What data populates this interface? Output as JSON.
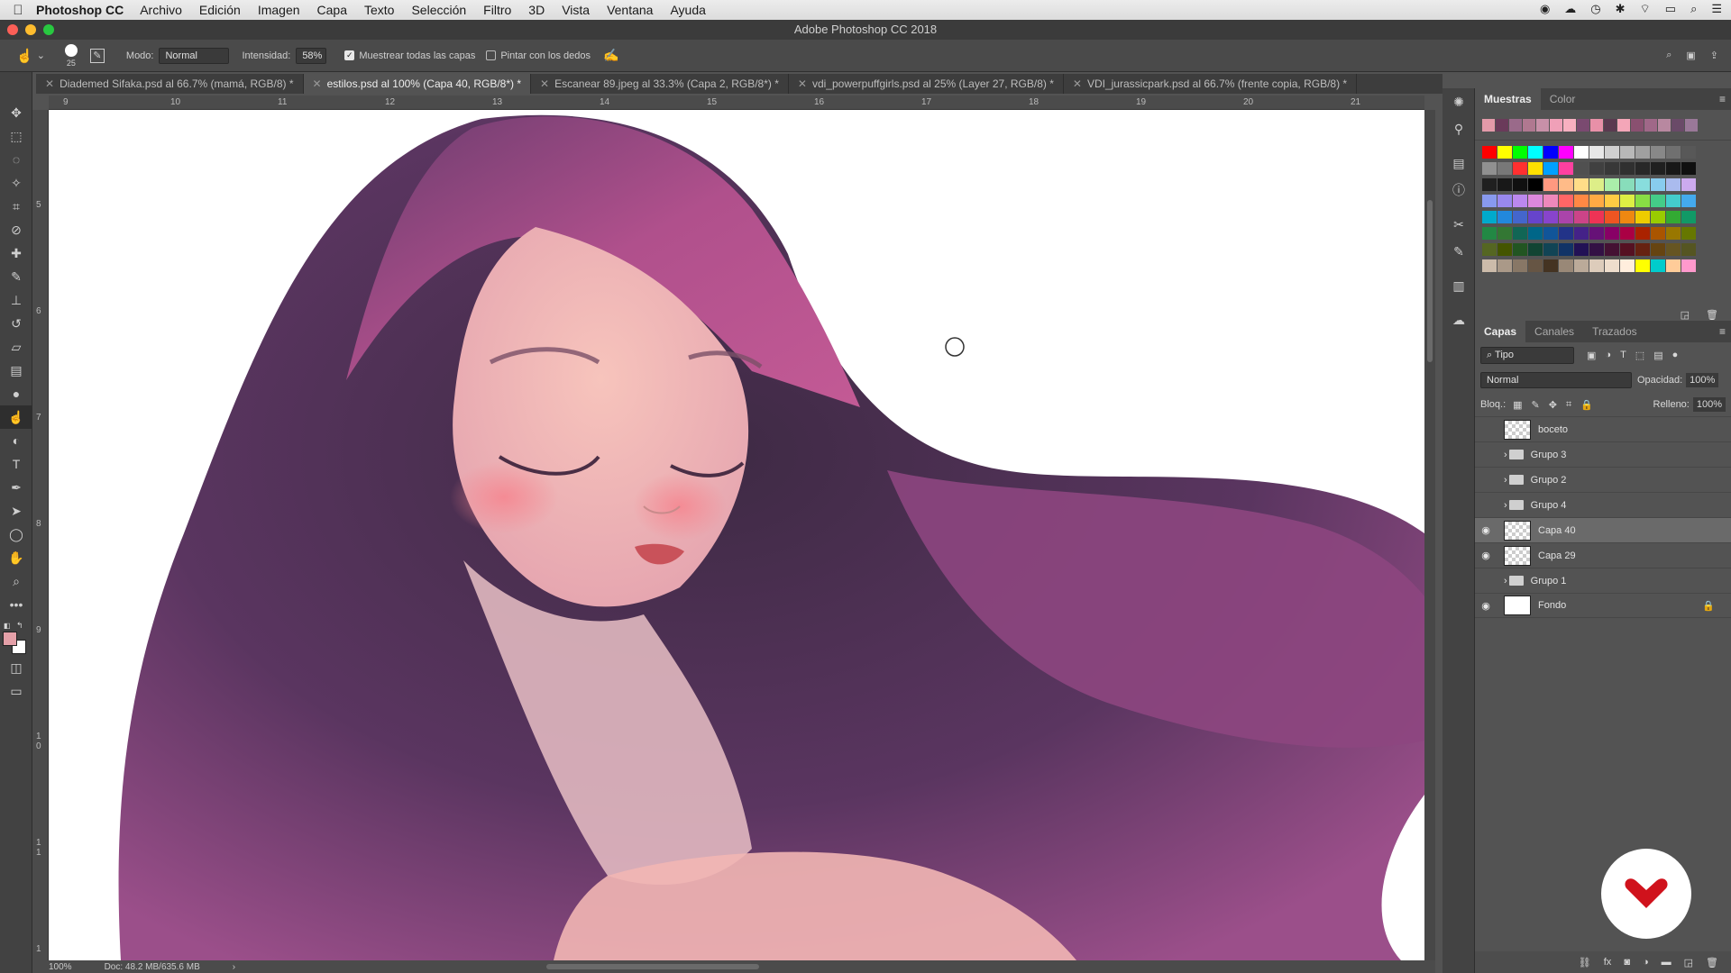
{
  "menubar": {
    "app_name": "Photoshop CC",
    "items": [
      "Archivo",
      "Edición",
      "Imagen",
      "Capa",
      "Texto",
      "Selección",
      "Filtro",
      "3D",
      "Vista",
      "Ventana",
      "Ayuda"
    ]
  },
  "window": {
    "title": "Adobe Photoshop CC 2018"
  },
  "options": {
    "brush_size": "25",
    "mode_label": "Modo:",
    "mode_value": "Normal",
    "strength_label": "Intensidad:",
    "strength_value": "58%",
    "sample_all_label": "Muestrear todas las capas",
    "finger_label": "Pintar con los dedos"
  },
  "tabs": [
    {
      "label": "Diademed Sifaka.psd al 66.7% (mamá, RGB/8) *"
    },
    {
      "label": "estilos.psd al 100% (Capa 40, RGB/8*) *"
    },
    {
      "label": "Escanear 89.jpeg al 33.3% (Capa 2, RGB/8*) *"
    },
    {
      "label": "vdi_powerpuffgirls.psd al 25% (Layer 27, RGB/8) *"
    },
    {
      "label": "VDI_jurassicpark.psd al 66.7% (frente copia, RGB/8) *"
    }
  ],
  "ruler": {
    "h_ticks": [
      "9",
      "10",
      "11",
      "12",
      "13",
      "14",
      "15",
      "16",
      "17",
      "18",
      "19",
      "20",
      "21"
    ],
    "v_ticks": [
      "5",
      "6",
      "7",
      "8",
      "9",
      "1 0",
      "1 1",
      "1"
    ]
  },
  "status": {
    "zoom": "100%",
    "doc": "Doc: 48.2 MB/635.6 MB"
  },
  "swatches_panel": {
    "tabs": [
      "Muestras",
      "Color"
    ],
    "recent": [
      "#e39aa9",
      "#6a3a5a",
      "#9a6a8a",
      "#b07890",
      "#c890a8",
      "#f0a0b8",
      "#f8b0c0",
      "#7a4a70",
      "#e890a8",
      "#5a3a50",
      "#f4a6b8",
      "#8a5070",
      "#a06888",
      "#b888a0",
      "#6a4a68",
      "#9a7898"
    ],
    "grid": [
      [
        "#ff0000",
        "#ffff00",
        "#00ff00",
        "#00ffff",
        "#0000ff",
        "#ff00ff",
        "#ffffff",
        "#e8e8e8",
        "#d0d0d0",
        "#b8b8b8",
        "#a0a0a0",
        "#888888",
        "#707070",
        "#585858"
      ],
      [
        "#909090",
        "#787878",
        "#ff3030",
        "#ffe000",
        "#00a0ff",
        "#ff40a0",
        "#505050",
        "#404040",
        "#383838",
        "#303030",
        "#282828",
        "#202020",
        "#181818",
        "#101010"
      ],
      [
        "#202020",
        "#181818",
        "#101010",
        "#000000",
        "#ff9980",
        "#ffbb88",
        "#ffdd88",
        "#ddee88",
        "#aaeeaa",
        "#88ddbb",
        "#88dddd",
        "#88ccee",
        "#aabbee",
        "#ccaaee"
      ],
      [
        "#8899ee",
        "#9988ee",
        "#bb88ee",
        "#dd88dd",
        "#ee88bb",
        "#ff6666",
        "#ff8844",
        "#ffaa44",
        "#ffcc44",
        "#ddee44",
        "#88dd44",
        "#44cc88",
        "#44cccc",
        "#44aaee"
      ],
      [
        "#00aacc",
        "#2288dd",
        "#4466cc",
        "#6644cc",
        "#8844cc",
        "#aa44aa",
        "#cc4488",
        "#ee3355",
        "#ee5522",
        "#ee8811",
        "#eecc00",
        "#99cc00",
        "#33aa33",
        "#119966"
      ],
      [
        "#228844",
        "#337733",
        "#116655",
        "#006688",
        "#115599",
        "#223388",
        "#442288",
        "#661177",
        "#880066",
        "#aa0044",
        "#aa2200",
        "#aa5500",
        "#997700",
        "#667700"
      ],
      [
        "#556622",
        "#445500",
        "#225522",
        "#114433",
        "#114455",
        "#113366",
        "#221155",
        "#331144",
        "#441133",
        "#551122",
        "#662211",
        "#664411",
        "#665522",
        "#555522"
      ],
      [
        "#ccbbaa",
        "#aa9988",
        "#887766",
        "#665544",
        "#443322",
        "#998877",
        "#bbaa99",
        "#ddccbb",
        "#eeddcc",
        "#ffeedd",
        "#ffff00",
        "#00cccc",
        "#ffcc99",
        "#ff99cc"
      ]
    ]
  },
  "layers_panel": {
    "tabs": [
      "Capas",
      "Canales",
      "Trazados"
    ],
    "filter_label": "Tipo",
    "blend_mode": "Normal",
    "opacity_label": "Opacidad:",
    "opacity_value": "100%",
    "lock_label": "Bloq.:",
    "fill_label": "Relleno:",
    "fill_value": "100%",
    "layers": [
      {
        "name": "boceto",
        "type": "layer",
        "visible": false
      },
      {
        "name": "Grupo 3",
        "type": "group",
        "visible": false
      },
      {
        "name": "Grupo 2",
        "type": "group",
        "visible": false
      },
      {
        "name": "Grupo 4",
        "type": "group",
        "visible": false
      },
      {
        "name": "Capa 40",
        "type": "layer",
        "visible": true,
        "selected": true
      },
      {
        "name": "Capa 29",
        "type": "layer",
        "visible": true
      },
      {
        "name": "Grupo 1",
        "type": "group",
        "visible": false
      },
      {
        "name": "Fondo",
        "type": "background",
        "visible": true,
        "locked": true
      }
    ]
  },
  "colors": {
    "foreground": "#e4a0a8",
    "background": "#ffffff",
    "hair_dark": "#4a2e4e",
    "hair_pink": "#b2508c",
    "skin": "#f2b6b4"
  }
}
